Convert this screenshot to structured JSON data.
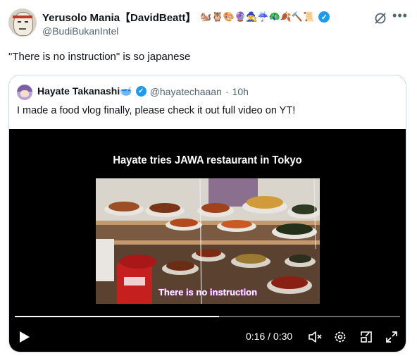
{
  "tweet": {
    "display_name": "Yerusolo Mania【DavidBeatt】",
    "name_emojis": "🐿️🦉🎨🔮🧙‍♀️☔🦚🍂🔨📜",
    "handle": "@BudiBukanIntel",
    "text": "\"There is no instruction\" is so japanese",
    "verified_icon": "verified-badge-icon",
    "actions": [
      "grok-icon",
      "more-icon"
    ]
  },
  "quote": {
    "display_name": "Hayate Takanashi🥣",
    "handle": "@hayatechaaan",
    "separator": "·",
    "time": "10h",
    "text": "I made a food vlog finally, please check it out full video on YT!",
    "video": {
      "title": "Hayate tries JAWA restaurant in Tokyo",
      "caption": "There is no instruction",
      "current_time": "0:16",
      "duration": "0:30",
      "time_display": "0:16 / 0:30",
      "progress": 0.53,
      "controls": [
        "play-icon",
        "mute-icon",
        "settings-icon",
        "pip-icon",
        "fullscreen-icon"
      ]
    }
  },
  "colors": {
    "verified_blue": "#1d9bf0",
    "secondary_text": "#536471",
    "border": "#cfd9de",
    "caption_pink": "#c33bd6"
  }
}
